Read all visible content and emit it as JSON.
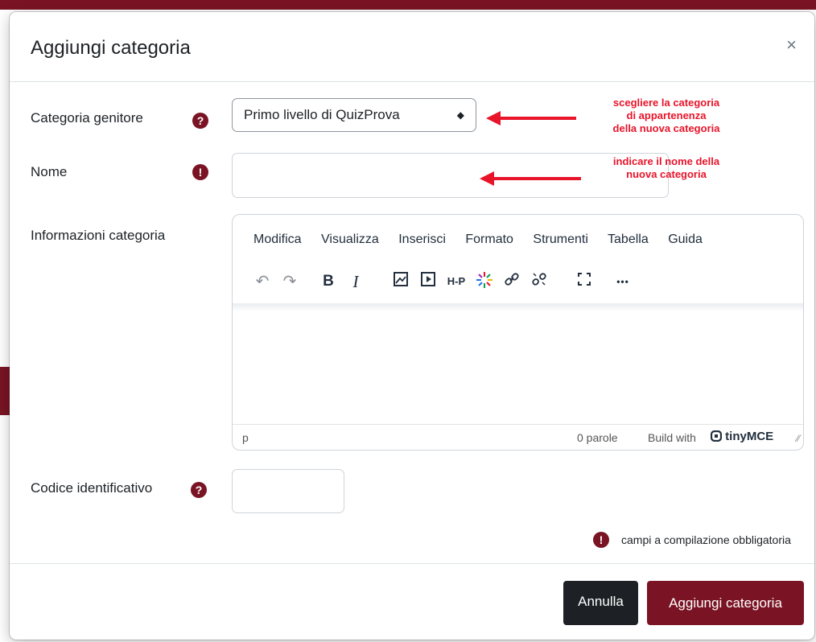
{
  "dialog": {
    "title": "Aggiungi categoria",
    "close_glyph": "×"
  },
  "fields": {
    "parent": {
      "label": "Categoria genitore",
      "value": "Primo livello di QuizProva",
      "help_icon": "question-icon"
    },
    "name": {
      "label": "Nome",
      "value": "",
      "required_icon": "exclamation-icon"
    },
    "info": {
      "label": "Informazioni categoria"
    },
    "idnumber": {
      "label": "Codice identificativo",
      "value": "",
      "help_icon": "question-icon"
    }
  },
  "editor": {
    "menu": [
      "Modifica",
      "Visualizza",
      "Inserisci",
      "Formato",
      "Strumenti",
      "Tabella",
      "Guida"
    ],
    "toolbar_icons": [
      "undo-icon",
      "redo-icon",
      "bold-icon",
      "italic-icon",
      "image-icon",
      "media-icon",
      "h5p-icon",
      "sparkle-icon",
      "link-icon",
      "unlink-icon",
      "fullscreen-icon",
      "more-icon"
    ],
    "toolbar": {
      "bold": "B",
      "italic": "I",
      "h5p": "H-P",
      "more": "•••"
    },
    "status_path": "p",
    "word_count": "0 parole",
    "build_with": "Build with",
    "brand": "tinyMCE"
  },
  "annotations": {
    "parent_note": [
      "scegliere la categoria",
      "di appartenenza",
      "della nuova categoria"
    ],
    "name_note": [
      "indicare il nome della",
      "nuova categoria"
    ],
    "color": "#e8142a"
  },
  "required_note": "campi a compilazione obbligatoria",
  "buttons": {
    "cancel": "Annulla",
    "submit": "Aggiungi categoria"
  },
  "colors": {
    "brand": "#7a1424",
    "cancel_bg": "#1d2125"
  }
}
